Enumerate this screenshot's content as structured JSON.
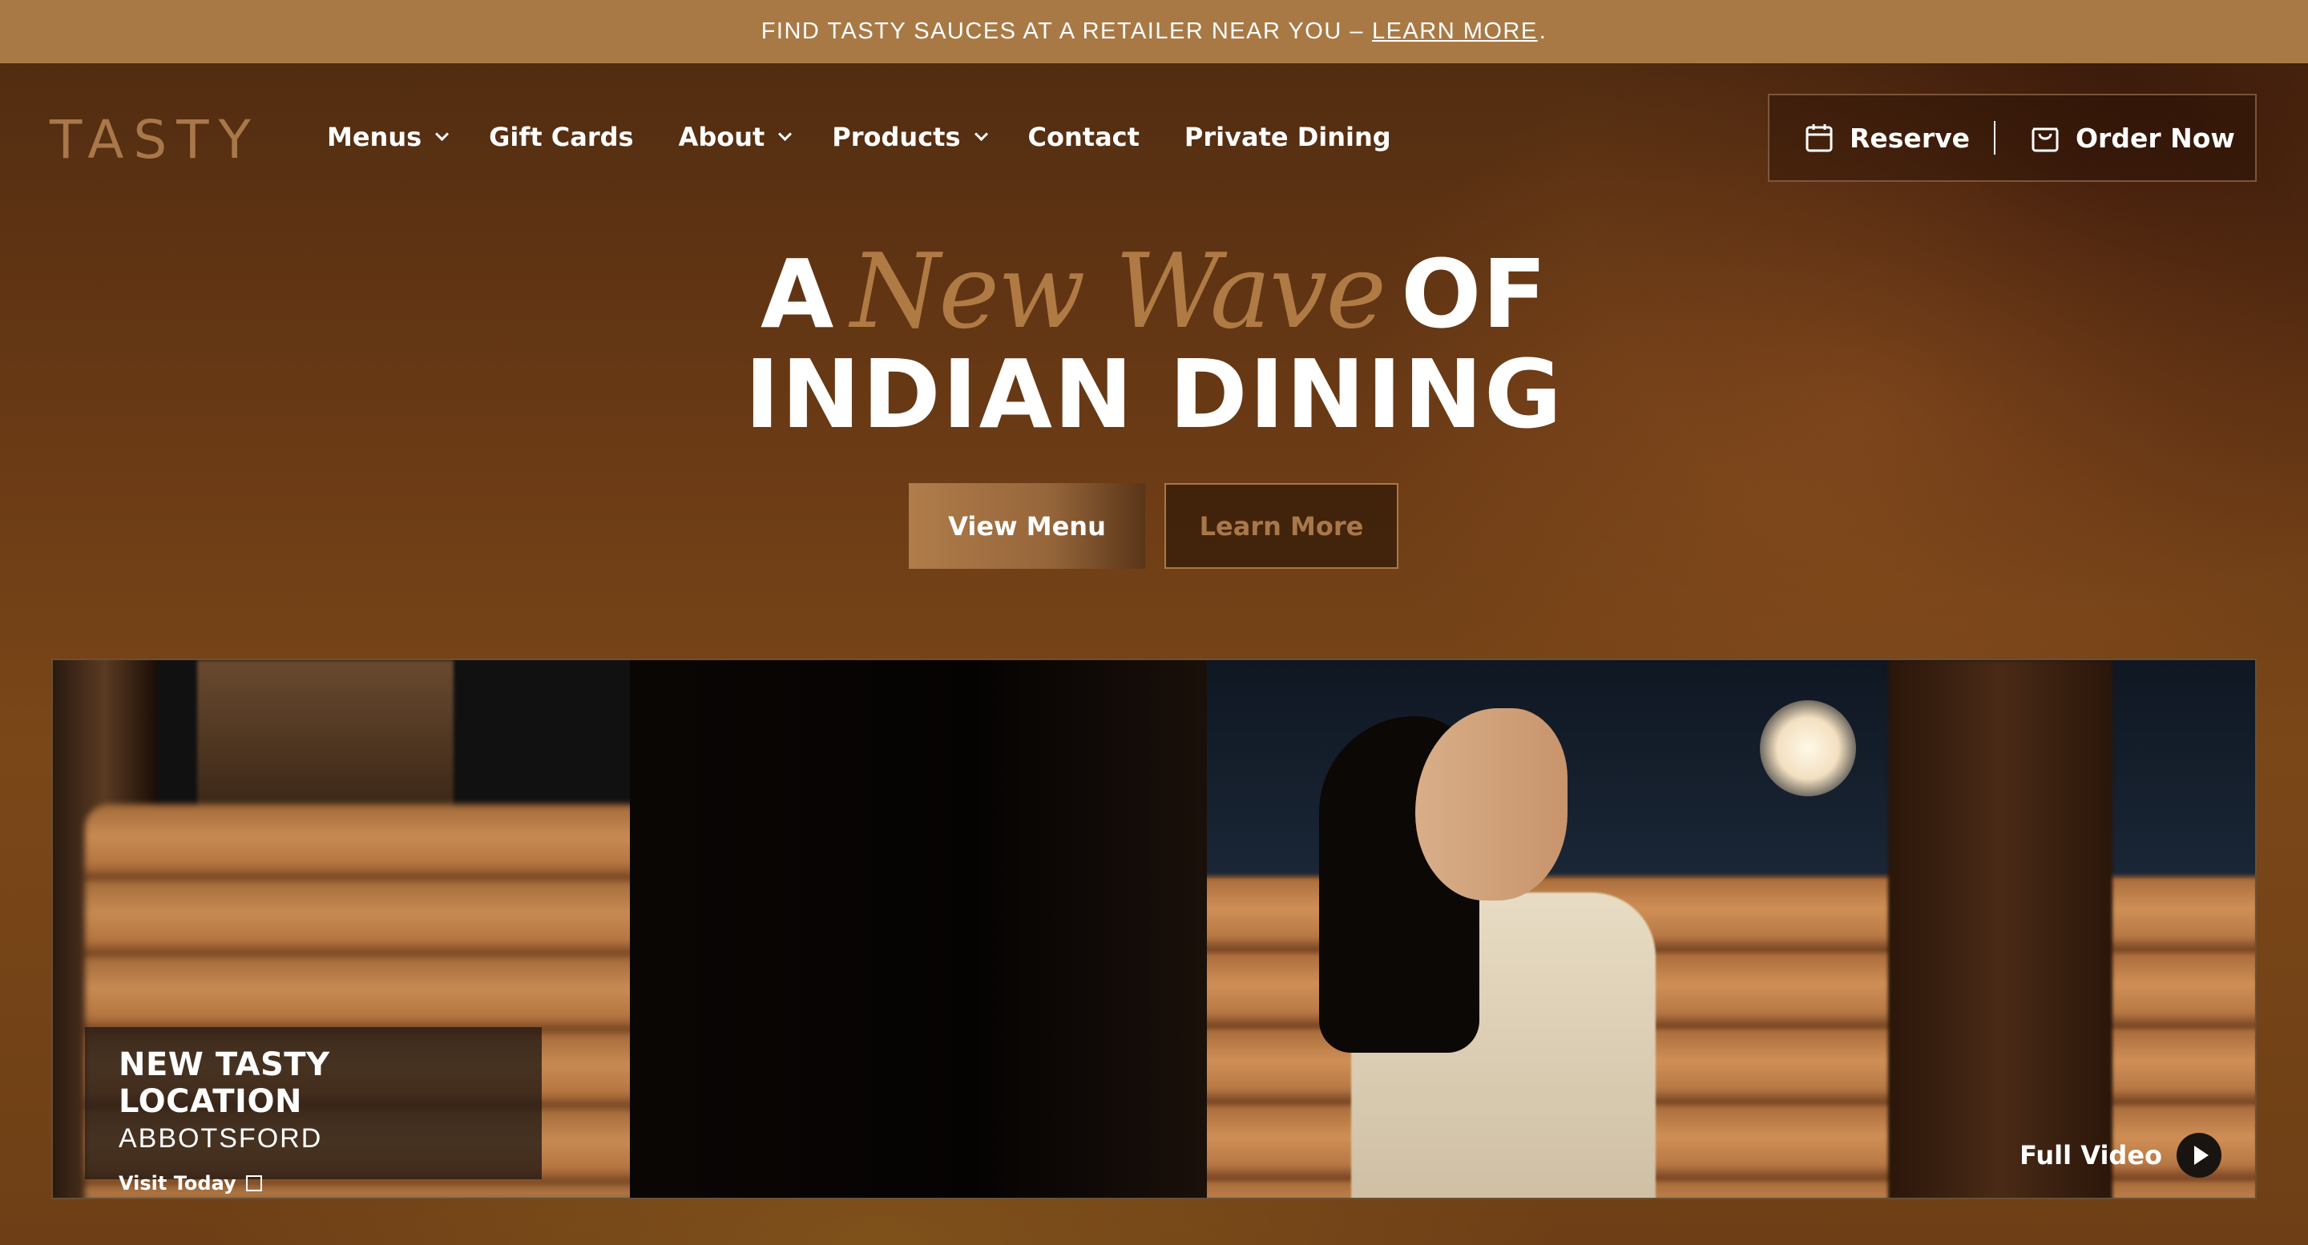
{
  "announcement": {
    "text": "FIND TASTY SAUCES AT A RETAILER NEAR YOU –",
    "link": "LEARN MORE",
    "end": "."
  },
  "logo": "TASTY",
  "nav": {
    "items": [
      {
        "label": "Menus",
        "dropdown": true
      },
      {
        "label": "Gift Cards",
        "dropdown": false
      },
      {
        "label": "About",
        "dropdown": true
      },
      {
        "label": "Products",
        "dropdown": true
      },
      {
        "label": "Contact",
        "dropdown": false
      },
      {
        "label": "Private Dining",
        "dropdown": false
      }
    ]
  },
  "cta": {
    "reserve": "Reserve",
    "order": "Order Now"
  },
  "hero": {
    "a": "A",
    "script": "New Wave",
    "of": "OF",
    "line2": "INDIAN DINING"
  },
  "buttons": {
    "primary": "View Menu",
    "secondary": "Learn More"
  },
  "video": {
    "location_title": "NEW TASTY LOCATION",
    "location_sub": "ABBOTSFORD",
    "location_link": "Visit Today",
    "full_video": "Full Video"
  },
  "colors": {
    "accent": "#a9784a",
    "topbar": "#a97945",
    "bg": "#6a3a15"
  }
}
